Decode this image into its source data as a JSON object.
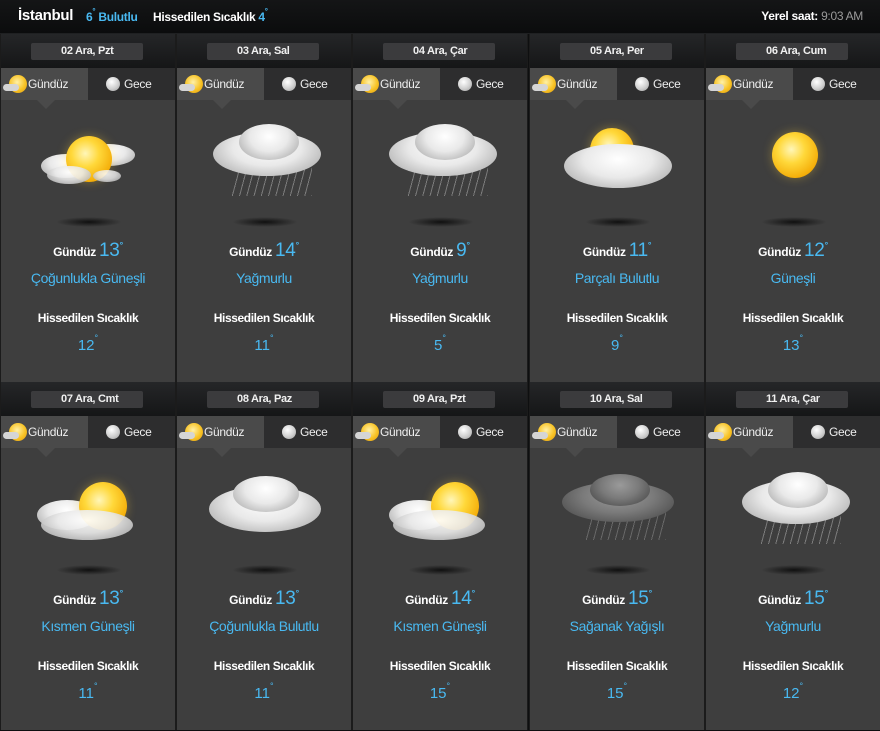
{
  "header": {
    "city": "İstanbul",
    "current_temp": "6",
    "current_condition": "Bulutlu",
    "feels_like_label": "Hissedilen Sıcaklık",
    "feels_like_value": "4",
    "local_time_label": "Yerel saat:",
    "local_time_value": "9:03 AM",
    "degree": "°"
  },
  "tabs": {
    "day": "Gündüz",
    "night": "Gece"
  },
  "labels": {
    "day_prefix": "Gündüz",
    "feels_like": "Hissedilen Sıcaklık"
  },
  "colors": {
    "accent": "#49b9f1",
    "card_bg": "#3e3e3e",
    "page_bg": "#0e0f10"
  },
  "days": [
    {
      "date": "02 Ara, Pzt",
      "temp": "13",
      "condition": "Çoğunlukla Güneşli",
      "feels": "12",
      "icon": "sun-with-small-clouds-icon"
    },
    {
      "date": "03 Ara, Sal",
      "temp": "14",
      "condition": "Yağmurlu",
      "feels": "11",
      "icon": "rain-cloud-icon"
    },
    {
      "date": "04 Ara, Çar",
      "temp": "9",
      "condition": "Yağmurlu",
      "feels": "5",
      "icon": "rain-cloud-icon"
    },
    {
      "date": "05 Ara, Per",
      "temp": "11",
      "condition": "Parçalı Bulutlu",
      "feels": "9",
      "icon": "partly-cloudy-icon"
    },
    {
      "date": "06 Ara, Cum",
      "temp": "12",
      "condition": "Güneşli",
      "feels": "13",
      "icon": "sun-icon"
    },
    {
      "date": "07 Ara, Cmt",
      "temp": "13",
      "condition": "Kısmen Güneşli",
      "feels": "11",
      "icon": "sun-behind-cloud-icon"
    },
    {
      "date": "08 Ara, Paz",
      "temp": "13",
      "condition": "Çoğunlukla Bulutlu",
      "feels": "11",
      "icon": "cloud-icon"
    },
    {
      "date": "09 Ara, Pzt",
      "temp": "14",
      "condition": "Kısmen Güneşli",
      "feels": "15",
      "icon": "sun-behind-cloud-icon"
    },
    {
      "date": "10 Ara, Sal",
      "temp": "15",
      "condition": "Sağanak Yağışlı",
      "feels": "15",
      "icon": "storm-cloud-icon"
    },
    {
      "date": "11 Ara, Çar",
      "temp": "15",
      "condition": "Yağmurlu",
      "feels": "12",
      "icon": "rain-cloud-icon"
    }
  ]
}
